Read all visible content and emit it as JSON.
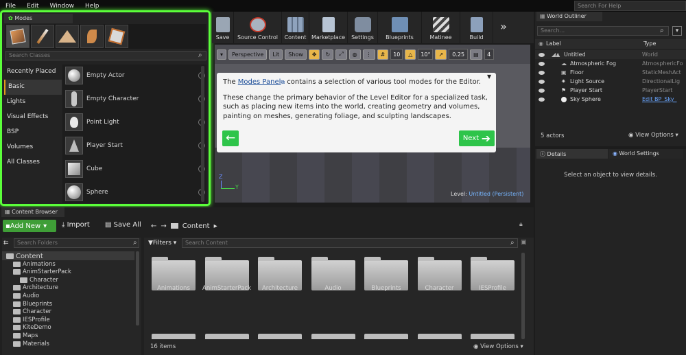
{
  "menu": [
    "File",
    "Edit",
    "Window",
    "Help"
  ],
  "help_search_placeholder": "Search For Help",
  "modes": {
    "tab_label": "Modes",
    "search_placeholder": "Search Classes",
    "categories": [
      "Recently Placed",
      "Basic",
      "Lights",
      "Visual Effects",
      "BSP",
      "Volumes",
      "All Classes"
    ],
    "active_category": "Basic",
    "items": [
      "Empty Actor",
      "Empty Character",
      "Point Light",
      "Player Start",
      "Cube",
      "Sphere"
    ]
  },
  "toolbar": {
    "buttons": [
      "Save",
      "Source Control",
      "Content",
      "Marketplace",
      "Settings",
      "Blueprints",
      "Matinee",
      "Build"
    ],
    "more": "»"
  },
  "viewport": {
    "perspective": "Perspective",
    "lit": "Lit",
    "show": "Show",
    "grid_snap": "10",
    "rot_snap": "10°",
    "scale_snap": "0.25",
    "camera_speed": "4",
    "level_label": "Level:",
    "level_name": "Untitled (Persistent)",
    "axis_z": "Z",
    "axis_y": "Y"
  },
  "tutorial": {
    "text_pre": "The ",
    "link": "Modes Panel",
    "text_post": " contains a selection of various tool modes for the Editor.",
    "body": "These change the primary behavior of the Level Editor for a specialized task, such as placing new items into the world, creating geometry and volumes, painting on meshes, generating foliage, and sculpting landscapes.",
    "back": "←",
    "next": "Next"
  },
  "outliner": {
    "tab_label": "World Outliner",
    "search_placeholder": "Search...",
    "col_label": "Label",
    "col_type": "Type",
    "rows": [
      {
        "label": "Untitled",
        "type": "World"
      },
      {
        "label": "Atmospheric Fog",
        "type": "AtmosphericFo"
      },
      {
        "label": "Floor",
        "type": "StaticMeshAct"
      },
      {
        "label": "Light Source",
        "type": "DirectionalLig"
      },
      {
        "label": "Player Start",
        "type": "PlayerStart"
      },
      {
        "label": "Sky Sphere",
        "type": "Edit BP_Sky_"
      }
    ],
    "actors_count": "5 actors",
    "view_options": "View Options"
  },
  "details": {
    "tab_details": "Details",
    "tab_world_settings": "World Settings",
    "empty_message": "Select an object to view details."
  },
  "content_browser": {
    "tab_label": "Content Browser",
    "add_new": "Add New",
    "import": "Import",
    "save_all": "Save All",
    "path_root": "Content",
    "search_folders_placeholder": "Search Folders",
    "filters": "Filters",
    "search_content_placeholder": "Search Content",
    "tree": [
      {
        "label": "Content",
        "level": 0
      },
      {
        "label": "Animations",
        "level": 1
      },
      {
        "label": "AnimStarterPack",
        "level": 1
      },
      {
        "label": "Character",
        "level": 2
      },
      {
        "label": "Architecture",
        "level": 1
      },
      {
        "label": "Audio",
        "level": 1
      },
      {
        "label": "Blueprints",
        "level": 1
      },
      {
        "label": "Character",
        "level": 1
      },
      {
        "label": "IESProfile",
        "level": 1
      },
      {
        "label": "KiteDemo",
        "level": 1
      },
      {
        "label": "Maps",
        "level": 1
      },
      {
        "label": "Materials",
        "level": 1
      }
    ],
    "folders": [
      "Animations",
      "AnimStarterPack",
      "Architecture",
      "Audio",
      "Blueprints",
      "Character",
      "IESProfile"
    ],
    "item_count": "16 items",
    "view_options": "View Options"
  },
  "colors": {
    "highlight": "#5bff3a",
    "add_new": "#3f9e37",
    "tutorial_button": "#2ec44a",
    "link": "#1d4e99"
  }
}
